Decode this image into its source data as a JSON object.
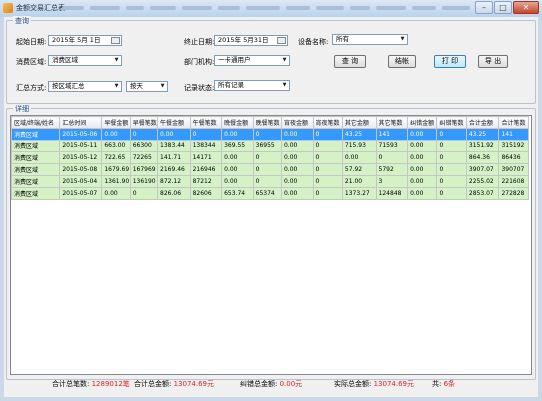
{
  "window": {
    "title": "金额交易汇总表",
    "colors": {
      "selected_row": "#3399ff",
      "data_row": "#d4f2c6",
      "status_value": "#e02020",
      "group_title": "#1a4b91"
    }
  },
  "query": {
    "group_title": "查询",
    "start_date_label": "起始日期:",
    "start_date_value": "2015年 5月 1日",
    "end_date_label": "终止日期:",
    "end_date_value": "2015年 5月31日",
    "device_label": "设备名称:",
    "device_value": "所有",
    "area_label": "消费区域:",
    "area_value": "消费区域",
    "dept_label": "部门机构:",
    "dept_value": "一卡通用户",
    "summary_label": "汇总方式:",
    "summary_value": "按区域汇总",
    "period_value": "按天",
    "record_label": "记录状态:",
    "record_value": "所有记录",
    "buttons": {
      "query": "查 询",
      "settle": "结帐",
      "print": "打 印",
      "export": "导 出"
    }
  },
  "details": {
    "group_title": "详细",
    "columns": [
      "区域/终端/姓名",
      "汇总时间",
      "早餐金额",
      "早餐笔数",
      "午餐金额",
      "午餐笔数",
      "晚餐金额",
      "晚餐笔数",
      "宵夜金额",
      "宵夜笔数",
      "其它金额",
      "其它笔数",
      "纠错金额",
      "纠错笔数",
      "合计金额",
      "合计笔数"
    ],
    "rows": [
      [
        "消费区域",
        "2015-05-06",
        "0.00",
        "0",
        "0.00",
        "0",
        "0.00",
        "0",
        "0.00",
        "0",
        "43.25",
        "141",
        "0.00",
        "0",
        "43.25",
        "141"
      ],
      [
        "消费区域",
        "2015-05-11",
        "663.00",
        "66300",
        "1383.44",
        "138344",
        "369.55",
        "36955",
        "0.00",
        "0",
        "715.93",
        "71593",
        "0.00",
        "0",
        "3151.92",
        "315192"
      ],
      [
        "消费区域",
        "2015-05-12",
        "722.65",
        "72265",
        "141.71",
        "14171",
        "0.00",
        "0",
        "0.00",
        "0",
        "0.00",
        "0",
        "0.00",
        "0",
        "864.36",
        "86436"
      ],
      [
        "消费区域",
        "2015-05-08",
        "1679.69",
        "167969",
        "2169.46",
        "216946",
        "0.00",
        "0",
        "0.00",
        "0",
        "57.92",
        "5792",
        "0.00",
        "0",
        "3907.07",
        "390707"
      ],
      [
        "消费区域",
        "2015-05-04",
        "1361.90",
        "136190",
        "872.12",
        "87212",
        "0.00",
        "0",
        "0.00",
        "0",
        "21.00",
        "3",
        "0.00",
        "0",
        "2255.02",
        "221608"
      ],
      [
        "消费区域",
        "2015-05-07",
        "0.00",
        "0",
        "826.06",
        "82606",
        "653.74",
        "65374",
        "0.00",
        "0",
        "1373.27",
        "124848",
        "0.00",
        "0",
        "2853.07",
        "272828"
      ]
    ]
  },
  "status": {
    "total_count_label": "合计总笔数:",
    "total_count_value": "1289012笔",
    "total_amount_label": "合计总金额:",
    "total_amount_value": "13074.69元",
    "correction_label": "纠错总金额:",
    "correction_value": "0.00元",
    "actual_label": "实际总金额:",
    "actual_value": "13074.69元",
    "pages_label": "共:",
    "pages_value": "6条"
  }
}
